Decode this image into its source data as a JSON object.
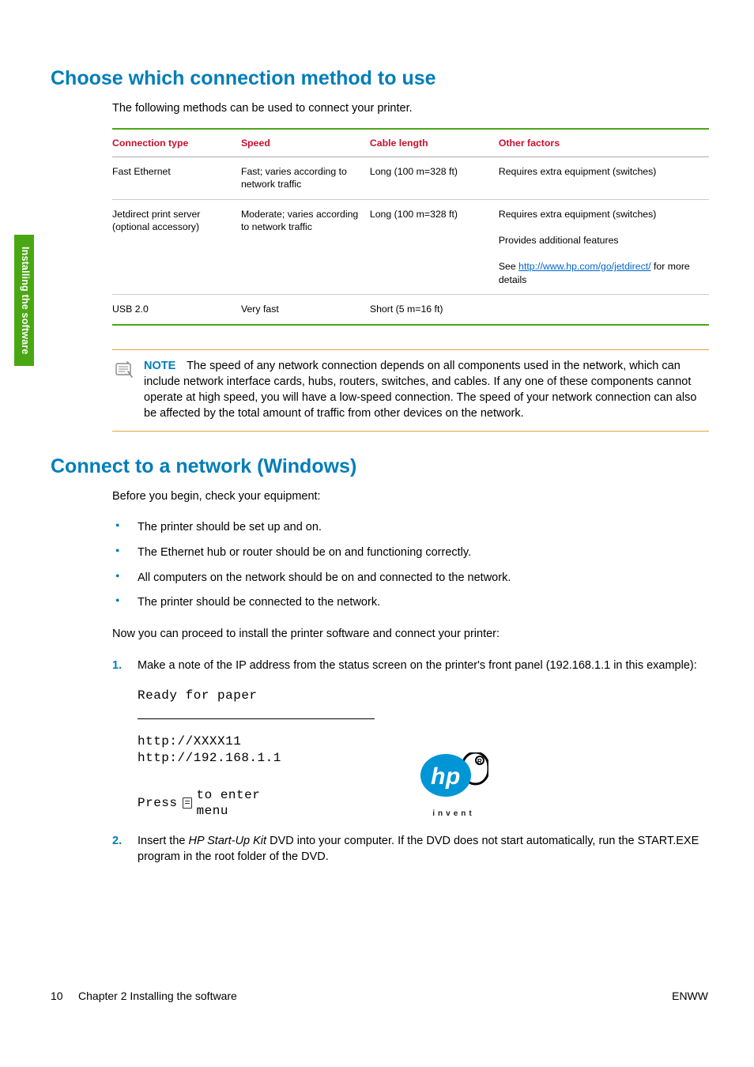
{
  "side_tab": "Installing the software",
  "h1_choose": "Choose which connection method to use",
  "intro_choose": "The following methods can be used to connect your printer.",
  "table": {
    "headers": [
      "Connection type",
      "Speed",
      "Cable length",
      "Other factors"
    ],
    "rows": [
      {
        "type": "Fast Ethernet",
        "speed": "Fast; varies according to network traffic",
        "cable": "Long (100 m=328 ft)",
        "other_parts": [
          {
            "text": "Requires extra equipment (switches)"
          }
        ]
      },
      {
        "type": "Jetdirect print server (optional accessory)",
        "speed": "Moderate; varies according to network traffic",
        "cable": "Long (100 m=328 ft)",
        "other_parts": [
          {
            "text": "Requires extra equipment (switches)"
          },
          {
            "br": true
          },
          {
            "text": "Provides additional features"
          },
          {
            "br": true
          },
          {
            "text": "See "
          },
          {
            "link": "http://www.hp.com/go/jetdirect/"
          },
          {
            "text": " for more details"
          }
        ]
      },
      {
        "type": "USB 2.0",
        "speed": "Very fast",
        "cable": "Short (5 m=16 ft)",
        "other_parts": []
      }
    ]
  },
  "note": {
    "label": "NOTE",
    "text": "The speed of any network connection depends on all components used in the network, which can include network interface cards, hubs, routers, switches, and cables. If any one of these components cannot operate at high speed, you will have a low-speed connection. The speed of your network connection can also be affected by the total amount of traffic from other devices on the network."
  },
  "h1_connect": "Connect to a network (Windows)",
  "intro_connect": "Before you begin, check your equipment:",
  "bullets": [
    "The printer should be set up and on.",
    "The Ethernet hub or router should be on and functioning correctly.",
    "All computers on the network should be on and connected to the network.",
    "The printer should be connected to the network."
  ],
  "proceed": "Now you can proceed to install the printer software and connect your printer:",
  "steps": {
    "s1_prefix": "Make a note of the IP address from the status screen on the printer's front panel (192.168.1.1 in this example):",
    "panel": {
      "line1": "Ready for paper",
      "line2": "http://XXXX11",
      "line3": "http://192.168.1.1",
      "press_pre": "Press",
      "press_post": "to enter\nmenu",
      "invent": "invent"
    },
    "s2_pre": "Insert the ",
    "s2_italic": "HP Start-Up Kit",
    "s2_post": " DVD into your computer. If the DVD does not start automatically, run the START.EXE program in the root folder of the DVD."
  },
  "footer": {
    "left_num": "10",
    "left_text": "Chapter 2   Installing the software",
    "right": "ENWW"
  }
}
